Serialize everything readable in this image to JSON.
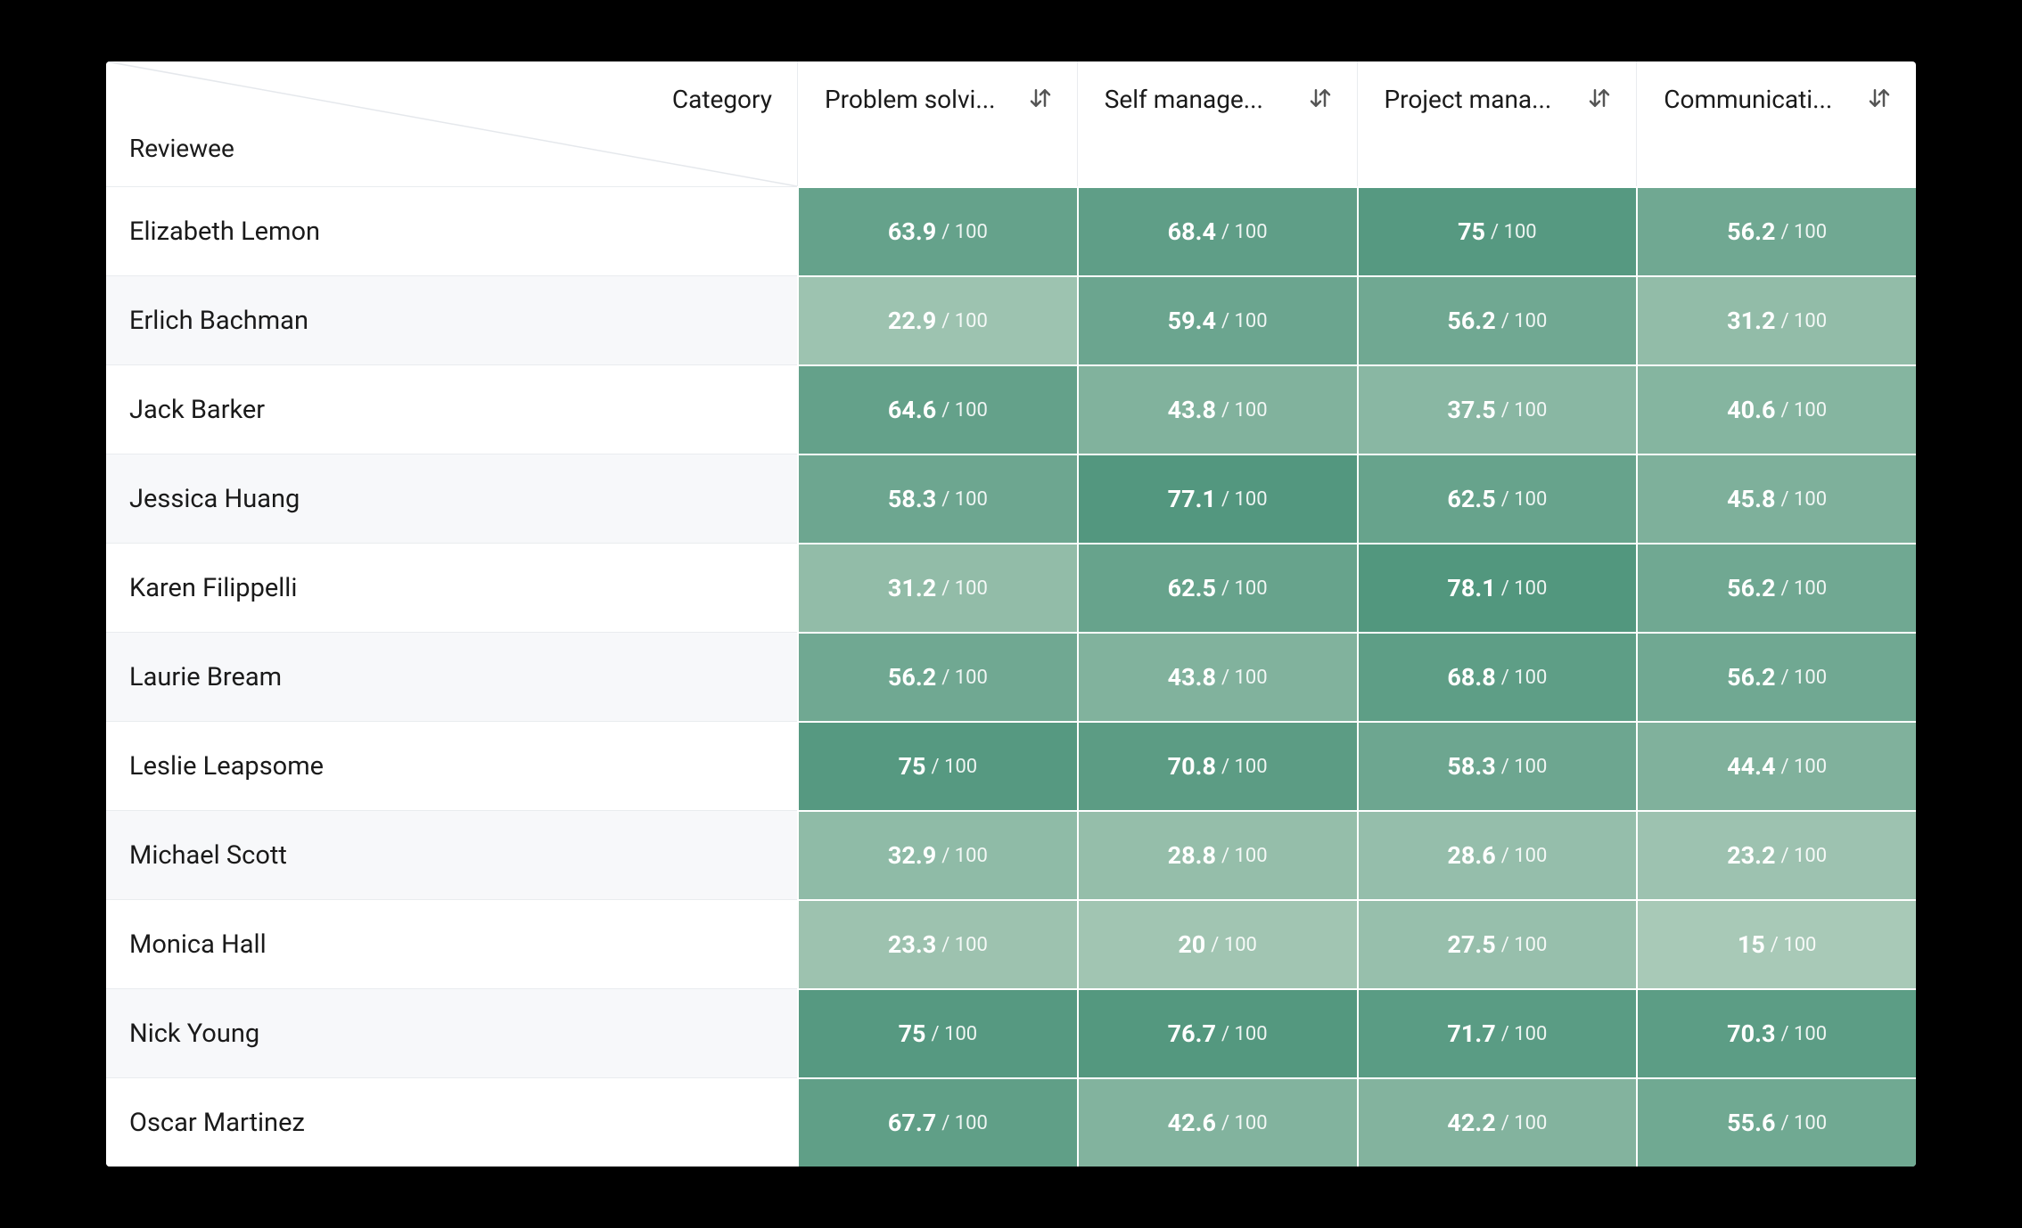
{
  "header": {
    "category_label": "Category",
    "reviewee_label": "Reviewee",
    "columns": [
      {
        "label": "Problem solvi..."
      },
      {
        "label": "Self manage..."
      },
      {
        "label": "Project mana..."
      },
      {
        "label": "Communicati..."
      }
    ]
  },
  "max_label": " / 100",
  "heat": {
    "min": 15,
    "max": 80,
    "low_color": "#a8c9b7",
    "high_color": "#4f957c"
  },
  "rows": [
    {
      "name": "Elizabeth Lemon",
      "scores": [
        63.9,
        68.4,
        75,
        56.2
      ]
    },
    {
      "name": "Erlich Bachman",
      "scores": [
        22.9,
        59.4,
        56.2,
        31.2
      ]
    },
    {
      "name": "Jack Barker",
      "scores": [
        64.6,
        43.8,
        37.5,
        40.6
      ]
    },
    {
      "name": "Jessica Huang",
      "scores": [
        58.3,
        77.1,
        62.5,
        45.8
      ]
    },
    {
      "name": "Karen Filippelli",
      "scores": [
        31.2,
        62.5,
        78.1,
        56.2
      ]
    },
    {
      "name": "Laurie Bream",
      "scores": [
        56.2,
        43.8,
        68.8,
        56.2
      ]
    },
    {
      "name": "Leslie Leapsome",
      "scores": [
        75,
        70.8,
        58.3,
        44.4
      ]
    },
    {
      "name": "Michael Scott",
      "scores": [
        32.9,
        28.8,
        28.6,
        23.2
      ]
    },
    {
      "name": "Monica Hall",
      "scores": [
        23.3,
        20,
        27.5,
        15
      ]
    },
    {
      "name": "Nick Young",
      "scores": [
        75,
        76.7,
        71.7,
        70.3
      ]
    },
    {
      "name": "Oscar Martinez",
      "scores": [
        67.7,
        42.6,
        42.2,
        55.6
      ]
    }
  ]
}
